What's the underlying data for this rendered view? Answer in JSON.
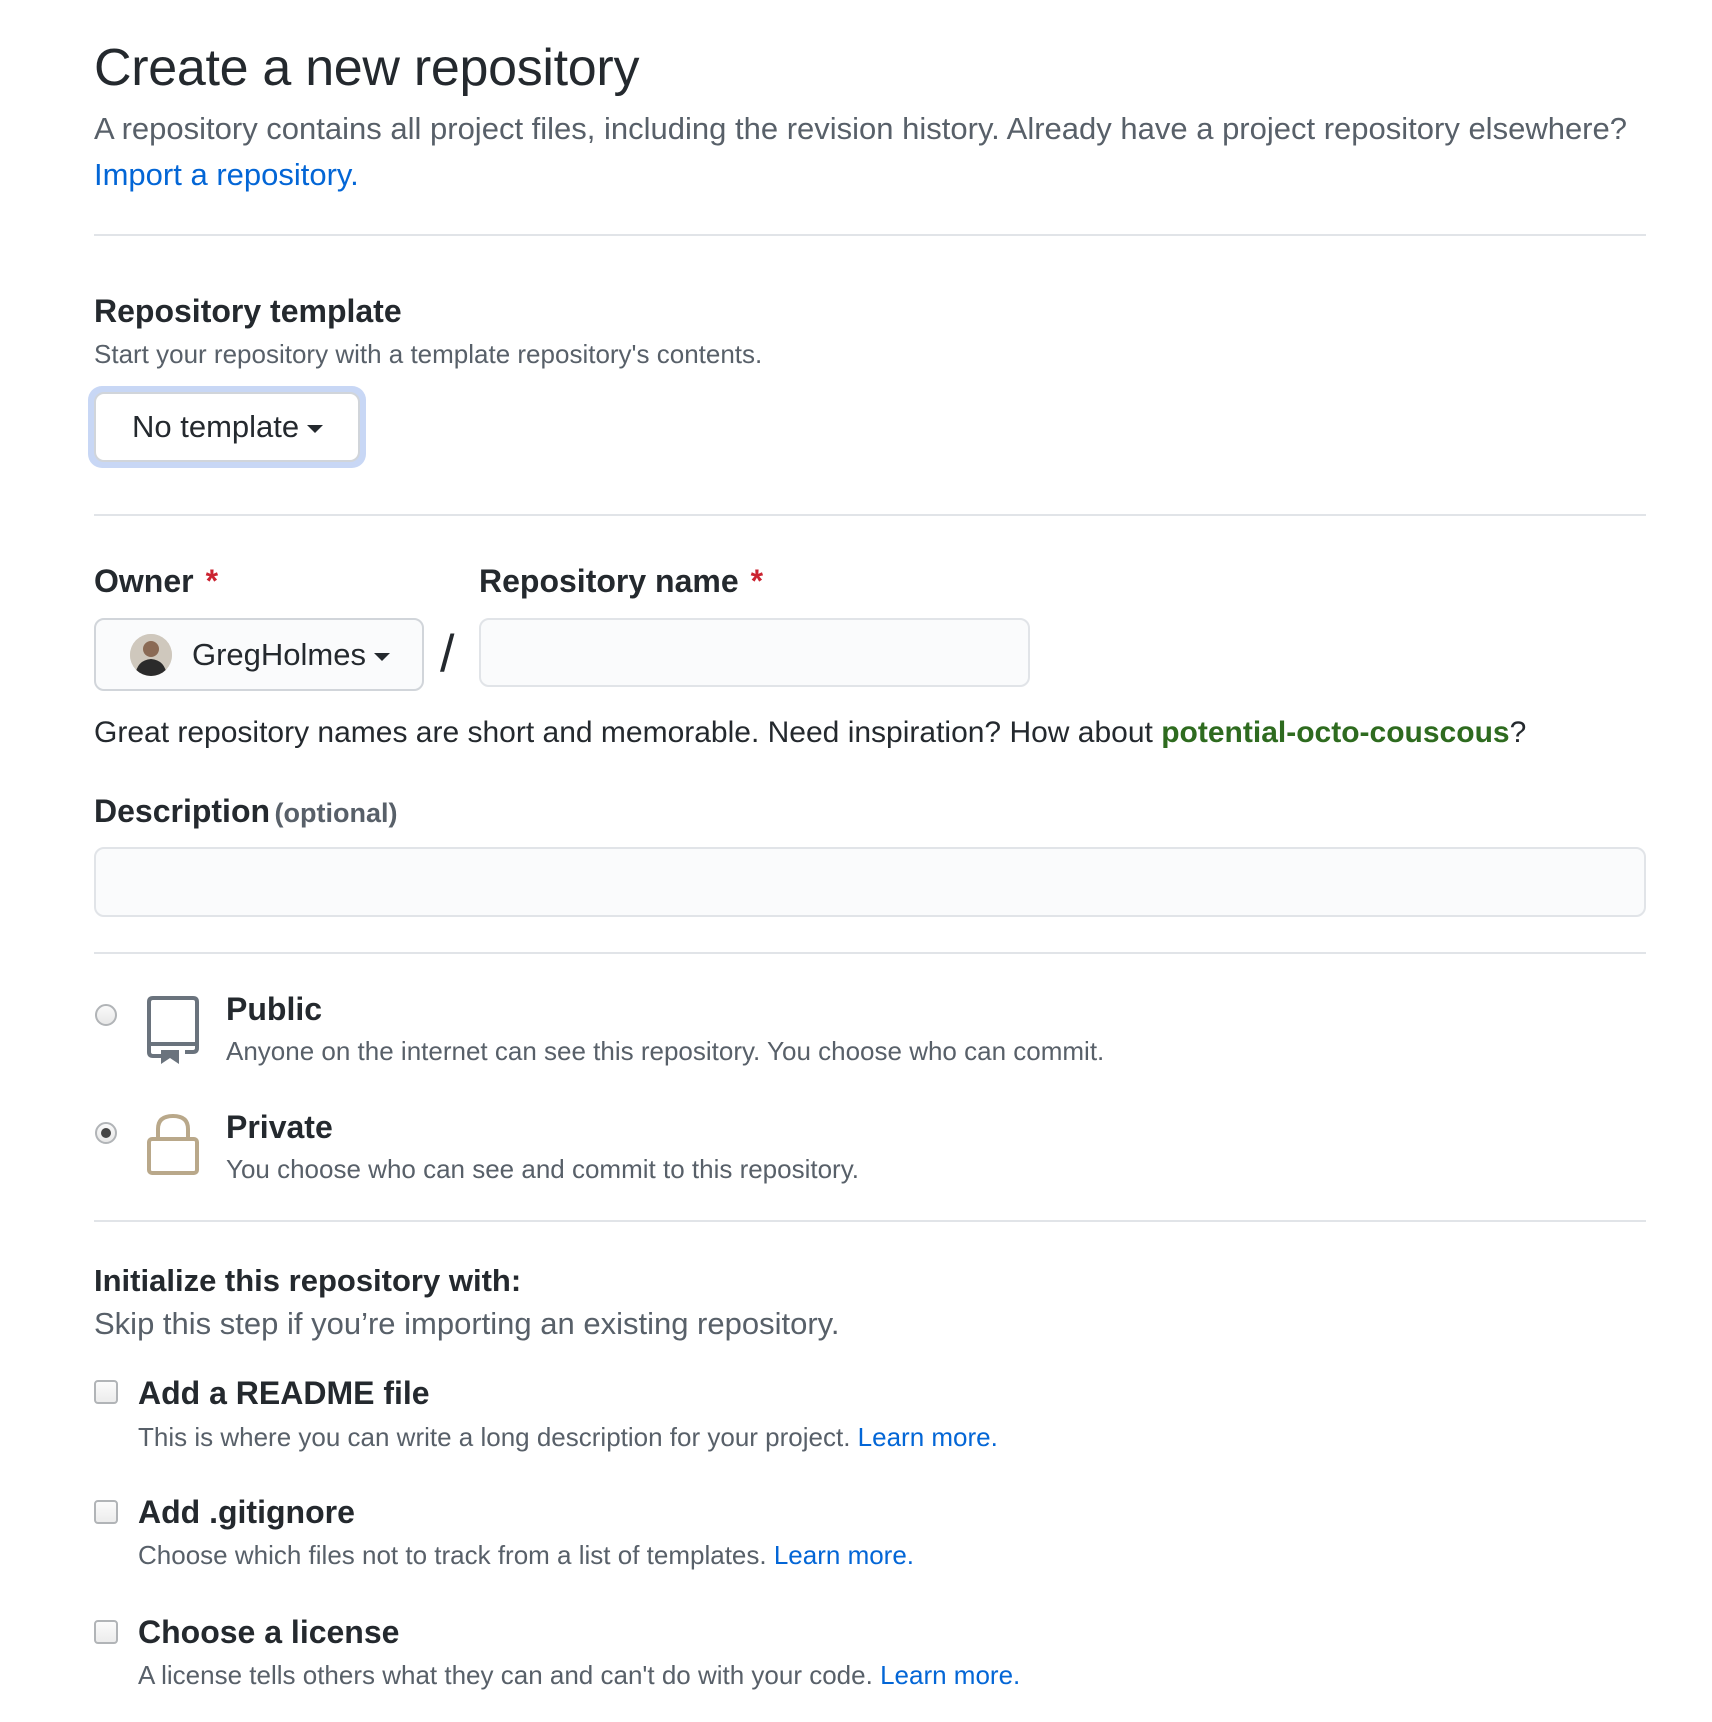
{
  "header": {
    "title": "Create a new repository",
    "subtitle": "A repository contains all project files, including the revision history. Already have a project repository elsewhere?",
    "import_link": "Import a repository."
  },
  "template": {
    "title": "Repository template",
    "description": "Start your repository with a template repository's contents.",
    "selected": "No template"
  },
  "owner": {
    "label": "Owner",
    "required_mark": "*",
    "selected": "GregHolmes"
  },
  "repo_name": {
    "label": "Repository name",
    "required_mark": "*",
    "value": "",
    "separator": "/"
  },
  "name_hint": {
    "text": "Great repository names are short and memorable. Need inspiration? How about",
    "suggestion": "potential-octo-couscous",
    "suffix": "?"
  },
  "description": {
    "label": "Description",
    "optional": "(optional)",
    "value": ""
  },
  "visibility": {
    "selected": "private",
    "options": [
      {
        "id": "public",
        "title": "Public",
        "desc": "Anyone on the internet can see this repository. You choose who can commit.",
        "icon": "repo-book-icon"
      },
      {
        "id": "private",
        "title": "Private",
        "desc": "You choose who can see and commit to this repository.",
        "icon": "lock-icon"
      }
    ]
  },
  "initialize": {
    "title": "Initialize this repository with:",
    "description": "Skip this step if you’re importing an existing repository.",
    "options": [
      {
        "title": "Add a README file",
        "desc": "This is where you can write a long description for your project.",
        "link": "Learn more.",
        "checked": false
      },
      {
        "title": "Add .gitignore",
        "desc": "Choose which files not to track from a list of templates.",
        "link": "Learn more.",
        "checked": false
      },
      {
        "title": "Choose a license",
        "desc": "A license tells others what they can and can't do with your code.",
        "link": "Learn more.",
        "checked": false
      }
    ]
  },
  "colors": {
    "link": "#0366d6",
    "suggestion": "#2e6b1f",
    "required": "#cb2431",
    "focus_ring": "#c8d7f5",
    "lock_icon": "#b9a88a"
  }
}
